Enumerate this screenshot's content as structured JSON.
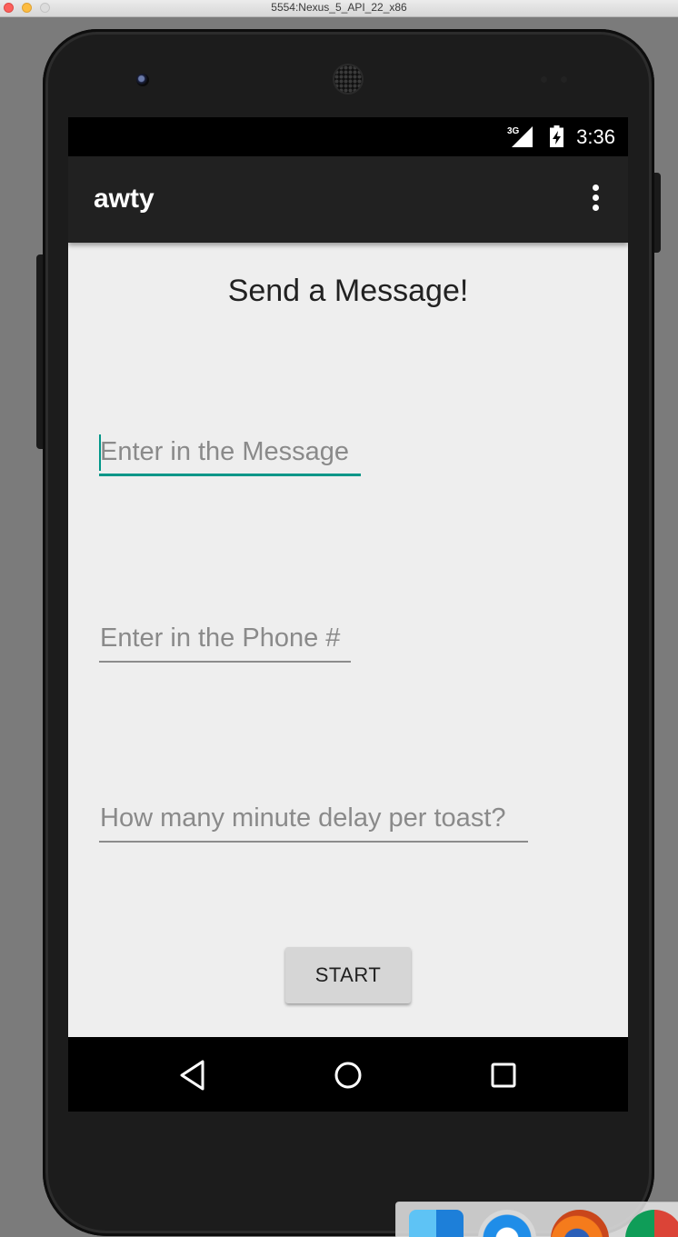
{
  "window": {
    "title": "5554:Nexus_5_API_22_x86"
  },
  "status_bar": {
    "network": "3G",
    "time": "3:36"
  },
  "app_bar": {
    "title": "awty",
    "overflow_icon": "more-vert-icon"
  },
  "main": {
    "heading": "Send a Message!",
    "message_field": {
      "placeholder": "Enter in the Message",
      "value": ""
    },
    "phone_field": {
      "placeholder": "Enter in the Phone #",
      "value": ""
    },
    "delay_field": {
      "placeholder": "How many minute delay per toast?",
      "value": ""
    },
    "start_button": "START"
  },
  "nav_bar": {
    "back_icon": "back-triangle-icon",
    "home_icon": "home-circle-icon",
    "recents_icon": "recents-square-icon"
  },
  "colors": {
    "accent": "#009688",
    "app_bar": "#212121",
    "background": "#eeeeee"
  }
}
